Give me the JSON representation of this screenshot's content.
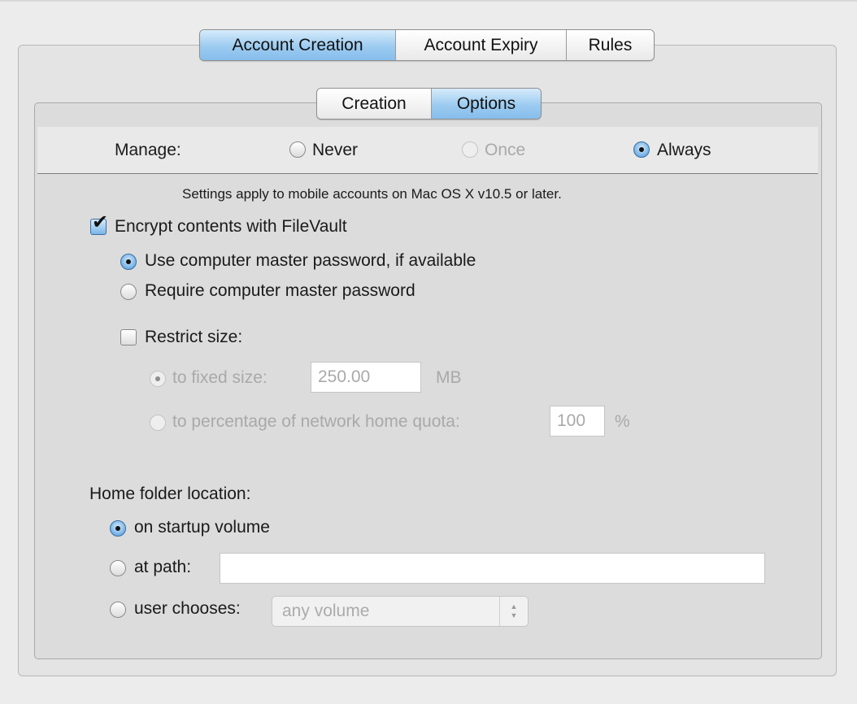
{
  "main_tabs": [
    {
      "label": "Account Creation",
      "selected": true
    },
    {
      "label": "Account Expiry",
      "selected": false
    },
    {
      "label": "Rules",
      "selected": false
    }
  ],
  "sub_tabs": [
    {
      "label": "Creation",
      "selected": false
    },
    {
      "label": "Options",
      "selected": true
    }
  ],
  "manage": {
    "label": "Manage:",
    "options": [
      {
        "label": "Never",
        "selected": false,
        "enabled": true
      },
      {
        "label": "Once",
        "selected": false,
        "enabled": false
      },
      {
        "label": "Always",
        "selected": true,
        "enabled": true
      }
    ]
  },
  "note": "Settings apply to mobile accounts on Mac OS X v10.5 or later.",
  "filevault": {
    "checkbox_label": "Encrypt contents with FileVault",
    "checked": true,
    "use_master_label": "Use computer master password, if available",
    "require_master_label": "Require computer master password",
    "selected": "use_master"
  },
  "restrict_size": {
    "label": "Restrict size:",
    "checked": false,
    "fixed_size_label": "to fixed size:",
    "fixed_size_value": "250.00",
    "fixed_size_unit": "MB",
    "percentage_label": "to percentage of network home quota:",
    "percentage_value": "100",
    "percentage_unit": "%"
  },
  "home_folder": {
    "label": "Home folder location:",
    "startup_label": "on startup volume",
    "path_label": "at path:",
    "path_value": "",
    "user_chooses_label": "user chooses:",
    "user_chooses_value": "any volume",
    "selected": "startup"
  }
}
